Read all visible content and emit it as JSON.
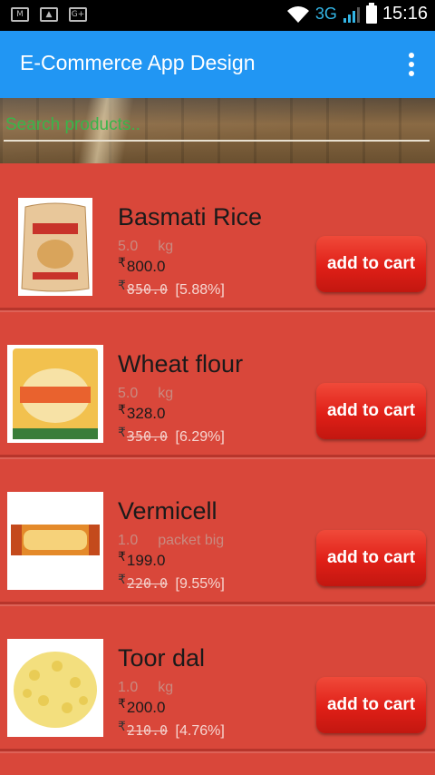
{
  "status_bar": {
    "icons": [
      "gmail-icon",
      "gallery-icon",
      "google-plus-icon"
    ],
    "network": "3G",
    "time": "15:16"
  },
  "app_bar": {
    "title": "E-Commerce App Design"
  },
  "search": {
    "placeholder": "Search products.."
  },
  "currency_symbol": "₹",
  "products": [
    {
      "name": "Basmati Rice",
      "qty": "5.0",
      "unit": "kg",
      "price": "800.0",
      "mrp": "850.0",
      "discount": "[5.88%]",
      "button": "add to cart"
    },
    {
      "name": "Wheat flour",
      "qty": "5.0",
      "unit": "kg",
      "price": "328.0",
      "mrp": "350.0",
      "discount": "[6.29%]",
      "button": "add to cart"
    },
    {
      "name": "Vermicell",
      "qty": "1.0",
      "unit": "packet big",
      "price": "199.0",
      "mrp": "220.0",
      "discount": "[9.55%]",
      "button": "add to cart"
    },
    {
      "name": "Toor dal",
      "qty": "1.0",
      "unit": "kg",
      "price": "200.0",
      "mrp": "210.0",
      "discount": "[4.76%]",
      "button": "add to cart"
    }
  ],
  "colors": {
    "app_bar": "#2196f3",
    "background": "#d9473a",
    "button": "#e01f17",
    "search_text": "#39b54a"
  }
}
